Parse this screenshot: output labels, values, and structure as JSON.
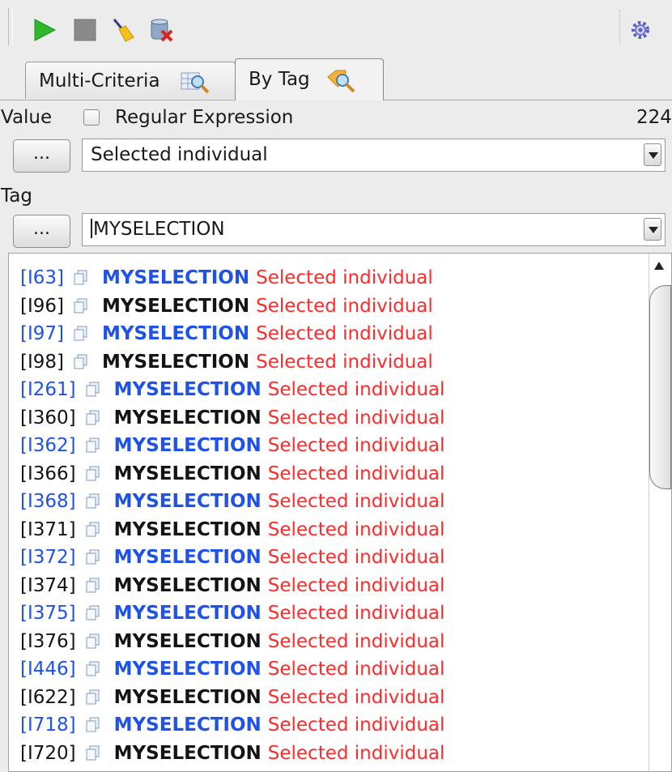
{
  "toolbar": {
    "icons": [
      "play-icon",
      "stop-icon",
      "broom-icon",
      "database-delete-icon",
      "gear-icon"
    ],
    "colors": {
      "play": "#2fb82b",
      "stop": "#8a8a8a"
    }
  },
  "tabs": [
    {
      "label": "Multi-Criteria",
      "icon": "magnifier-grid-icon",
      "selected": false
    },
    {
      "label": "By Tag",
      "icon": "tag-magnifier-icon",
      "selected": true
    }
  ],
  "value_label": "Value",
  "regex": {
    "label": "Regular Expression",
    "checked": false
  },
  "count": "224",
  "value_button": "...",
  "value_selected": "Selected individual",
  "tag_label": "Tag",
  "tag_button": "...",
  "tag_value": "MYSELECTION",
  "colors": {
    "blue_text": "#1f52e8",
    "red_text": "#ff2a2a"
  },
  "results": [
    {
      "id": "[I63]",
      "tag": "MYSELECTION",
      "value": "Selected individual",
      "color": "blue"
    },
    {
      "id": "[I96]",
      "tag": "MYSELECTION",
      "value": "Selected individual",
      "color": "black"
    },
    {
      "id": "[I97]",
      "tag": "MYSELECTION",
      "value": "Selected individual",
      "color": "blue"
    },
    {
      "id": "[I98]",
      "tag": "MYSELECTION",
      "value": "Selected individual",
      "color": "black"
    },
    {
      "id": "[I261]",
      "tag": "MYSELECTION",
      "value": "Selected individual",
      "color": "blue"
    },
    {
      "id": "[I360]",
      "tag": "MYSELECTION",
      "value": "Selected individual",
      "color": "black"
    },
    {
      "id": "[I362]",
      "tag": "MYSELECTION",
      "value": "Selected individual",
      "color": "blue"
    },
    {
      "id": "[I366]",
      "tag": "MYSELECTION",
      "value": "Selected individual",
      "color": "black"
    },
    {
      "id": "[I368]",
      "tag": "MYSELECTION",
      "value": "Selected individual",
      "color": "blue"
    },
    {
      "id": "[I371]",
      "tag": "MYSELECTION",
      "value": "Selected individual",
      "color": "black"
    },
    {
      "id": "[I372]",
      "tag": "MYSELECTION",
      "value": "Selected individual",
      "color": "blue"
    },
    {
      "id": "[I374]",
      "tag": "MYSELECTION",
      "value": "Selected individual",
      "color": "black"
    },
    {
      "id": "[I375]",
      "tag": "MYSELECTION",
      "value": "Selected individual",
      "color": "blue"
    },
    {
      "id": "[I376]",
      "tag": "MYSELECTION",
      "value": "Selected individual",
      "color": "black"
    },
    {
      "id": "[I446]",
      "tag": "MYSELECTION",
      "value": "Selected individual",
      "color": "blue"
    },
    {
      "id": "[I622]",
      "tag": "MYSELECTION",
      "value": "Selected individual",
      "color": "black"
    },
    {
      "id": "[I718]",
      "tag": "MYSELECTION",
      "value": "Selected individual",
      "color": "blue"
    },
    {
      "id": "[I720]",
      "tag": "MYSELECTION",
      "value": "Selected individual",
      "color": "black"
    }
  ]
}
